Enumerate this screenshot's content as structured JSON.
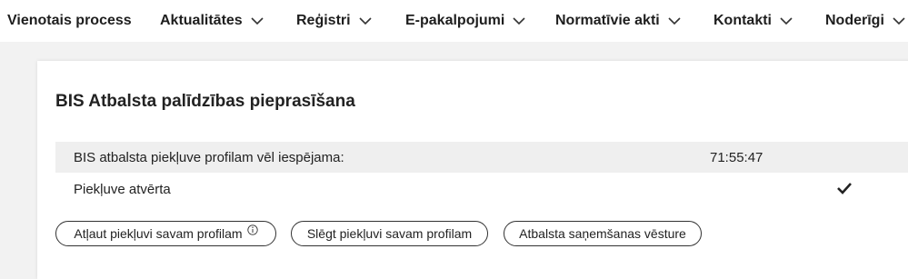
{
  "nav": {
    "items": [
      {
        "label": "Vienotais process",
        "has_dropdown": false
      },
      {
        "label": "Aktualitātes",
        "has_dropdown": true
      },
      {
        "label": "Reģistri",
        "has_dropdown": true
      },
      {
        "label": "E-pakalpojumi",
        "has_dropdown": true
      },
      {
        "label": "Normatīvie akti",
        "has_dropdown": true
      },
      {
        "label": "Kontakti",
        "has_dropdown": true
      },
      {
        "label": "Noderīgi",
        "has_dropdown": true
      }
    ]
  },
  "card": {
    "title": "BIS Atbalsta palīdzības pieprasīšana",
    "access_remaining_label": "BIS atbalsta piekļuve profilam vēl iespējama:",
    "access_remaining_value": "71:55:47",
    "access_status_label": "Piekļuve atvērta",
    "access_status_icon": "checkmark-icon",
    "buttons": {
      "allow": "Atļaut piekļuvi savam profilam",
      "close": "Slēgt piekļuvi savam profilam",
      "history": "Atbalsta saņemšanas vēsture"
    }
  },
  "colors": {
    "page_bg": "#f2f2f2",
    "row_shade": "#efefef",
    "text": "#1e1e1e"
  }
}
